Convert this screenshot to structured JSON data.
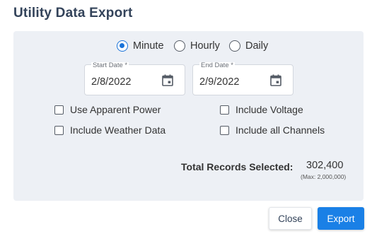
{
  "dialog": {
    "title": "Utility Data Export"
  },
  "interval": {
    "selected": "Minute",
    "options": [
      {
        "label": "Minute",
        "checked": true
      },
      {
        "label": "Hourly",
        "checked": false
      },
      {
        "label": "Daily",
        "checked": false
      }
    ]
  },
  "dates": {
    "start": {
      "label": "Start Date *",
      "value": "2/8/2022",
      "icon": "calendar-icon"
    },
    "end": {
      "label": "End Date *",
      "value": "2/9/2022",
      "icon": "calendar-icon"
    }
  },
  "options": {
    "use_apparent_power": {
      "label": "Use Apparent Power",
      "checked": false
    },
    "include_voltage": {
      "label": "Include Voltage",
      "checked": false
    },
    "include_weather": {
      "label": "Include Weather Data",
      "checked": false
    },
    "include_all_channels": {
      "label": "Include all Channels",
      "checked": false
    }
  },
  "totals": {
    "label": "Total Records Selected:",
    "value": "302,400",
    "max": "(Max: 2,000,000)"
  },
  "buttons": {
    "close": "Close",
    "export": "Export"
  },
  "colors": {
    "accent": "#1a80e6",
    "panel_bg": "#edf0f5",
    "title": "#33435a"
  }
}
